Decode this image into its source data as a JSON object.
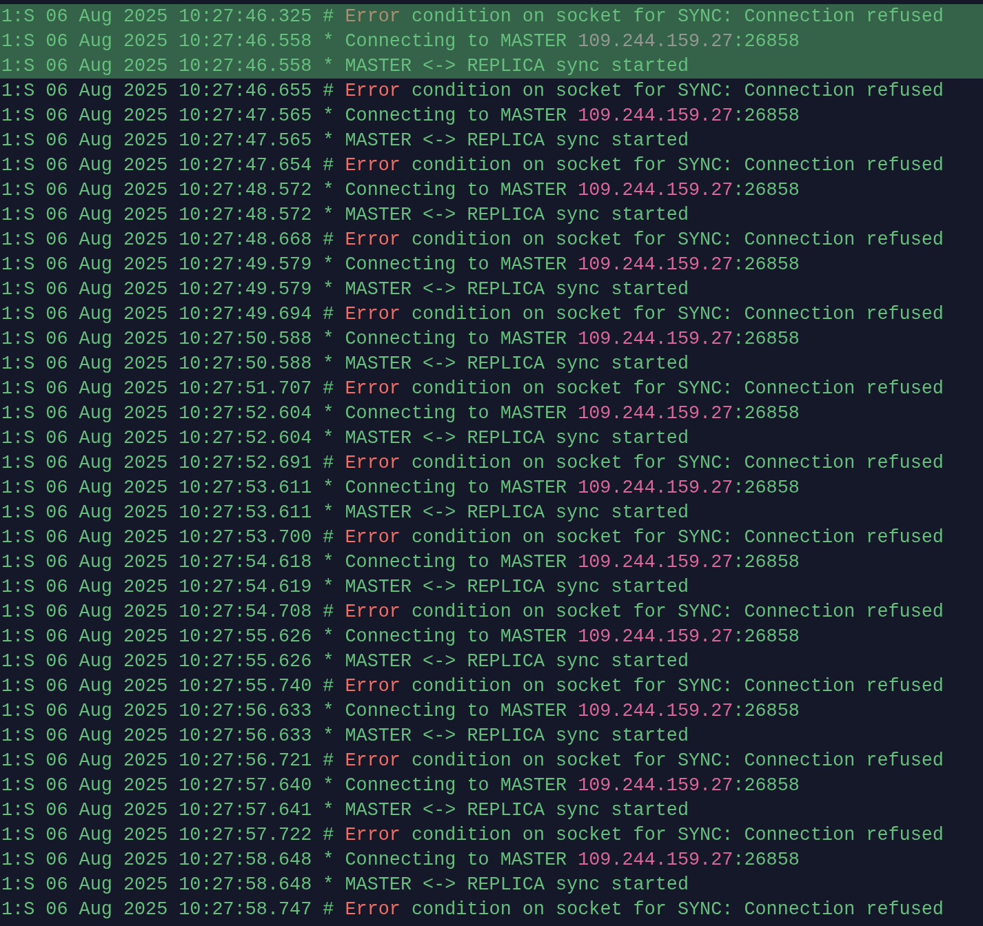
{
  "terminal": {
    "lines": [
      {
        "selected": true,
        "segments": [
          {
            "text": "1:S 06 Aug 2025 10:27:46.325 # ",
            "kind": "plain"
          },
          {
            "text": "Error",
            "kind": "error"
          },
          {
            "text": " condition on socket for SYNC: Connection refused",
            "kind": "plain"
          }
        ]
      },
      {
        "selected": true,
        "segments": [
          {
            "text": "1:S 06 Aug 2025 10:27:46.558 * Connecting to MASTER ",
            "kind": "plain"
          },
          {
            "text": "109.244.159.27",
            "kind": "address"
          },
          {
            "text": ":26858",
            "kind": "plain"
          }
        ]
      },
      {
        "selected": true,
        "segments": [
          {
            "text": "1:S 06 Aug 2025 10:27:46.558 * MASTER <-> REPLICA sync started",
            "kind": "plain"
          }
        ]
      },
      {
        "selected": false,
        "segments": [
          {
            "text": "1:S 06 Aug 2025 10:27:46.655 # ",
            "kind": "plain"
          },
          {
            "text": "Error",
            "kind": "error"
          },
          {
            "text": " condition on socket for SYNC: Connection refused",
            "kind": "plain"
          }
        ]
      },
      {
        "selected": false,
        "segments": [
          {
            "text": "1:S 06 Aug 2025 10:27:47.565 * Connecting to MASTER ",
            "kind": "plain"
          },
          {
            "text": "109.244.159.27",
            "kind": "address"
          },
          {
            "text": ":26858",
            "kind": "plain"
          }
        ]
      },
      {
        "selected": false,
        "segments": [
          {
            "text": "1:S 06 Aug 2025 10:27:47.565 * MASTER <-> REPLICA sync started",
            "kind": "plain"
          }
        ]
      },
      {
        "selected": false,
        "segments": [
          {
            "text": "1:S 06 Aug 2025 10:27:47.654 # ",
            "kind": "plain"
          },
          {
            "text": "Error",
            "kind": "error"
          },
          {
            "text": " condition on socket for SYNC: Connection refused",
            "kind": "plain"
          }
        ]
      },
      {
        "selected": false,
        "segments": [
          {
            "text": "1:S 06 Aug 2025 10:27:48.572 * Connecting to MASTER ",
            "kind": "plain"
          },
          {
            "text": "109.244.159.27",
            "kind": "address"
          },
          {
            "text": ":26858",
            "kind": "plain"
          }
        ]
      },
      {
        "selected": false,
        "segments": [
          {
            "text": "1:S 06 Aug 2025 10:27:48.572 * MASTER <-> REPLICA sync started",
            "kind": "plain"
          }
        ]
      },
      {
        "selected": false,
        "segments": [
          {
            "text": "1:S 06 Aug 2025 10:27:48.668 # ",
            "kind": "plain"
          },
          {
            "text": "Error",
            "kind": "error"
          },
          {
            "text": " condition on socket for SYNC: Connection refused",
            "kind": "plain"
          }
        ]
      },
      {
        "selected": false,
        "segments": [
          {
            "text": "1:S 06 Aug 2025 10:27:49.579 * Connecting to MASTER ",
            "kind": "plain"
          },
          {
            "text": "109.244.159.27",
            "kind": "address"
          },
          {
            "text": ":26858",
            "kind": "plain"
          }
        ]
      },
      {
        "selected": false,
        "segments": [
          {
            "text": "1:S 06 Aug 2025 10:27:49.579 * MASTER <-> REPLICA sync started",
            "kind": "plain"
          }
        ]
      },
      {
        "selected": false,
        "segments": [
          {
            "text": "1:S 06 Aug 2025 10:27:49.694 # ",
            "kind": "plain"
          },
          {
            "text": "Error",
            "kind": "error"
          },
          {
            "text": " condition on socket for SYNC: Connection refused",
            "kind": "plain"
          }
        ]
      },
      {
        "selected": false,
        "segments": [
          {
            "text": "1:S 06 Aug 2025 10:27:50.588 * Connecting to MASTER ",
            "kind": "plain"
          },
          {
            "text": "109.244.159.27",
            "kind": "address"
          },
          {
            "text": ":26858",
            "kind": "plain"
          }
        ]
      },
      {
        "selected": false,
        "segments": [
          {
            "text": "1:S 06 Aug 2025 10:27:50.588 * MASTER <-> REPLICA sync started",
            "kind": "plain"
          }
        ]
      },
      {
        "selected": false,
        "segments": [
          {
            "text": "1:S 06 Aug 2025 10:27:51.707 # ",
            "kind": "plain"
          },
          {
            "text": "Error",
            "kind": "error"
          },
          {
            "text": " condition on socket for SYNC: Connection refused",
            "kind": "plain"
          }
        ]
      },
      {
        "selected": false,
        "segments": [
          {
            "text": "1:S 06 Aug 2025 10:27:52.604 * Connecting to MASTER ",
            "kind": "plain"
          },
          {
            "text": "109.244.159.27",
            "kind": "address"
          },
          {
            "text": ":26858",
            "kind": "plain"
          }
        ]
      },
      {
        "selected": false,
        "segments": [
          {
            "text": "1:S 06 Aug 2025 10:27:52.604 * MASTER <-> REPLICA sync started",
            "kind": "plain"
          }
        ]
      },
      {
        "selected": false,
        "segments": [
          {
            "text": "1:S 06 Aug 2025 10:27:52.691 # ",
            "kind": "plain"
          },
          {
            "text": "Error",
            "kind": "error"
          },
          {
            "text": " condition on socket for SYNC: Connection refused",
            "kind": "plain"
          }
        ]
      },
      {
        "selected": false,
        "segments": [
          {
            "text": "1:S 06 Aug 2025 10:27:53.611 * Connecting to MASTER ",
            "kind": "plain"
          },
          {
            "text": "109.244.159.27",
            "kind": "address"
          },
          {
            "text": ":26858",
            "kind": "plain"
          }
        ]
      },
      {
        "selected": false,
        "segments": [
          {
            "text": "1:S 06 Aug 2025 10:27:53.611 * MASTER <-> REPLICA sync started",
            "kind": "plain"
          }
        ]
      },
      {
        "selected": false,
        "segments": [
          {
            "text": "1:S 06 Aug 2025 10:27:53.700 # ",
            "kind": "plain"
          },
          {
            "text": "Error",
            "kind": "error"
          },
          {
            "text": " condition on socket for SYNC: Connection refused",
            "kind": "plain"
          }
        ]
      },
      {
        "selected": false,
        "segments": [
          {
            "text": "1:S 06 Aug 2025 10:27:54.618 * Connecting to MASTER ",
            "kind": "plain"
          },
          {
            "text": "109.244.159.27",
            "kind": "address"
          },
          {
            "text": ":26858",
            "kind": "plain"
          }
        ]
      },
      {
        "selected": false,
        "segments": [
          {
            "text": "1:S 06 Aug 2025 10:27:54.619 * MASTER <-> REPLICA sync started",
            "kind": "plain"
          }
        ]
      },
      {
        "selected": false,
        "segments": [
          {
            "text": "1:S 06 Aug 2025 10:27:54.708 # ",
            "kind": "plain"
          },
          {
            "text": "Error",
            "kind": "error"
          },
          {
            "text": " condition on socket for SYNC: Connection refused",
            "kind": "plain"
          }
        ]
      },
      {
        "selected": false,
        "segments": [
          {
            "text": "1:S 06 Aug 2025 10:27:55.626 * Connecting to MASTER ",
            "kind": "plain"
          },
          {
            "text": "109.244.159.27",
            "kind": "address"
          },
          {
            "text": ":26858",
            "kind": "plain"
          }
        ]
      },
      {
        "selected": false,
        "segments": [
          {
            "text": "1:S 06 Aug 2025 10:27:55.626 * MASTER <-> REPLICA sync started",
            "kind": "plain"
          }
        ]
      },
      {
        "selected": false,
        "segments": [
          {
            "text": "1:S 06 Aug 2025 10:27:55.740 # ",
            "kind": "plain"
          },
          {
            "text": "Error",
            "kind": "error"
          },
          {
            "text": " condition on socket for SYNC: Connection refused",
            "kind": "plain"
          }
        ]
      },
      {
        "selected": false,
        "segments": [
          {
            "text": "1:S 06 Aug 2025 10:27:56.633 * Connecting to MASTER ",
            "kind": "plain"
          },
          {
            "text": "109.244.159.27",
            "kind": "address"
          },
          {
            "text": ":26858",
            "kind": "plain"
          }
        ]
      },
      {
        "selected": false,
        "segments": [
          {
            "text": "1:S 06 Aug 2025 10:27:56.633 * MASTER <-> REPLICA sync started",
            "kind": "plain"
          }
        ]
      },
      {
        "selected": false,
        "segments": [
          {
            "text": "1:S 06 Aug 2025 10:27:56.721 # ",
            "kind": "plain"
          },
          {
            "text": "Error",
            "kind": "error"
          },
          {
            "text": " condition on socket for SYNC: Connection refused",
            "kind": "plain"
          }
        ]
      },
      {
        "selected": false,
        "segments": [
          {
            "text": "1:S 06 Aug 2025 10:27:57.640 * Connecting to MASTER ",
            "kind": "plain"
          },
          {
            "text": "109.244.159.27",
            "kind": "address"
          },
          {
            "text": ":26858",
            "kind": "plain"
          }
        ]
      },
      {
        "selected": false,
        "segments": [
          {
            "text": "1:S 06 Aug 2025 10:27:57.641 * MASTER <-> REPLICA sync started",
            "kind": "plain"
          }
        ]
      },
      {
        "selected": false,
        "segments": [
          {
            "text": "1:S 06 Aug 2025 10:27:57.722 # ",
            "kind": "plain"
          },
          {
            "text": "Error",
            "kind": "error"
          },
          {
            "text": " condition on socket for SYNC: Connection refused",
            "kind": "plain"
          }
        ]
      },
      {
        "selected": false,
        "segments": [
          {
            "text": "1:S 06 Aug 2025 10:27:58.648 * Connecting to MASTER ",
            "kind": "plain"
          },
          {
            "text": "109.244.159.27",
            "kind": "address"
          },
          {
            "text": ":26858",
            "kind": "plain"
          }
        ]
      },
      {
        "selected": false,
        "segments": [
          {
            "text": "1:S 06 Aug 2025 10:27:58.648 * MASTER <-> REPLICA sync started",
            "kind": "plain"
          }
        ]
      },
      {
        "selected": false,
        "segments": [
          {
            "text": "1:S 06 Aug 2025 10:27:58.747 # ",
            "kind": "plain"
          },
          {
            "text": "Error",
            "kind": "error"
          },
          {
            "text": " condition on socket for SYNC: Connection refused",
            "kind": "plain"
          }
        ]
      }
    ]
  }
}
